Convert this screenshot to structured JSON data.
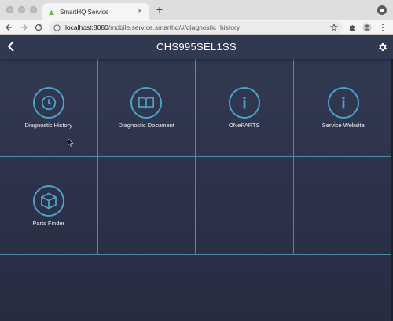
{
  "browser": {
    "tab_title": "SmartHQ Service",
    "tab_close": "×",
    "new_tab": "+",
    "url_host": "localhost:8080",
    "url_rest": "/mobile.service.smarthq/#/diagnostic_history"
  },
  "app": {
    "title": "CHS995SEL1SS",
    "tiles": [
      {
        "label": "Diagnostic History",
        "icon": "clock-icon"
      },
      {
        "label": "Diagnostic Document",
        "icon": "open-book-icon"
      },
      {
        "label": "ONePARTS",
        "icon": "info-icon"
      },
      {
        "label": "Service Website",
        "icon": "info-icon"
      },
      {
        "label": "Parts Finder",
        "icon": "box-icon"
      },
      {
        "label": "",
        "icon": ""
      },
      {
        "label": "",
        "icon": ""
      },
      {
        "label": "",
        "icon": ""
      }
    ]
  },
  "colors": {
    "accent": "#4aa3c9",
    "app_bg": "#2b3147",
    "grid_line": "#4e8aa6"
  }
}
